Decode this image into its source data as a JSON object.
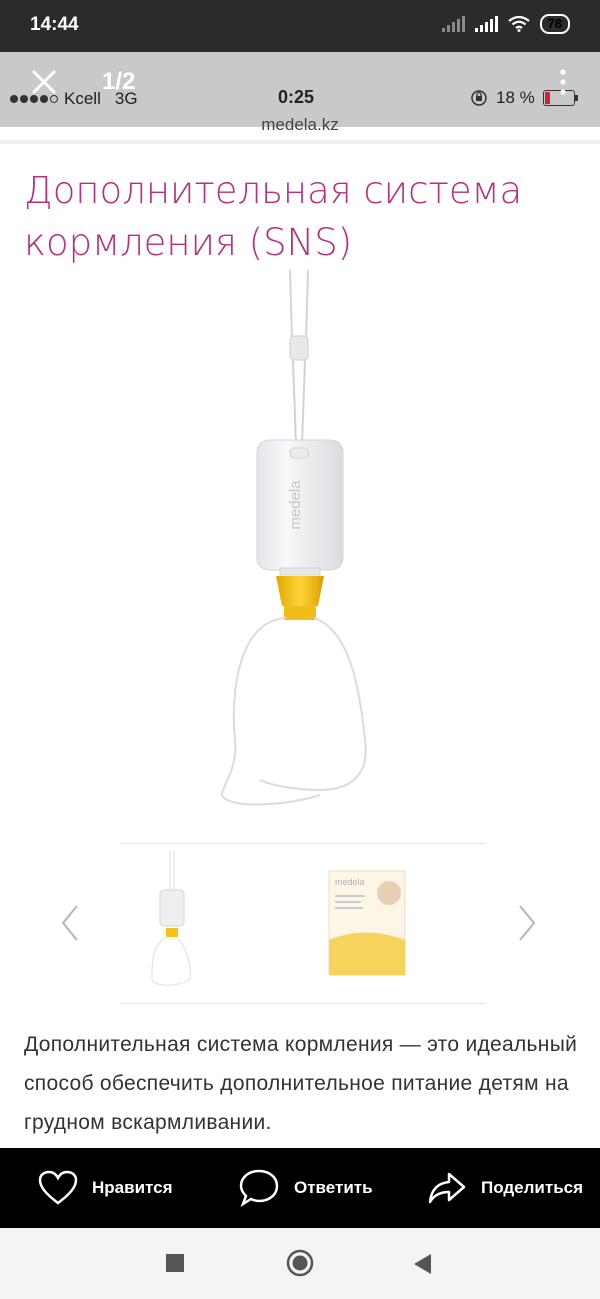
{
  "android_status": {
    "time": "14:44",
    "battery": "78"
  },
  "viewer": {
    "counter": "1/2"
  },
  "ios_status": {
    "carrier": "Kcell",
    "network": "3G",
    "time": "0:25",
    "battery": "18 %"
  },
  "page": {
    "url": "medela.kz",
    "title": "Дополнительная система кормления (SNS)",
    "description": "Дополнительная система кормления — это идеальный способ обеспечить дополнительное питание детям на грудном вскармливании.",
    "product_brand": "medela",
    "thumb_brand": "medela"
  },
  "actions": {
    "like": "Нравится",
    "reply": "Ответить",
    "share": "Поделиться"
  },
  "colors": {
    "title": "#b5307f",
    "accent_yellow": "#f7c318",
    "action_bar": "#000000"
  },
  "icons": [
    "close-icon",
    "more-icon",
    "heart-icon",
    "comment-icon",
    "share-icon",
    "chevron-left-icon",
    "chevron-right-icon",
    "nav-recents-icon",
    "nav-home-icon",
    "nav-back-icon"
  ]
}
